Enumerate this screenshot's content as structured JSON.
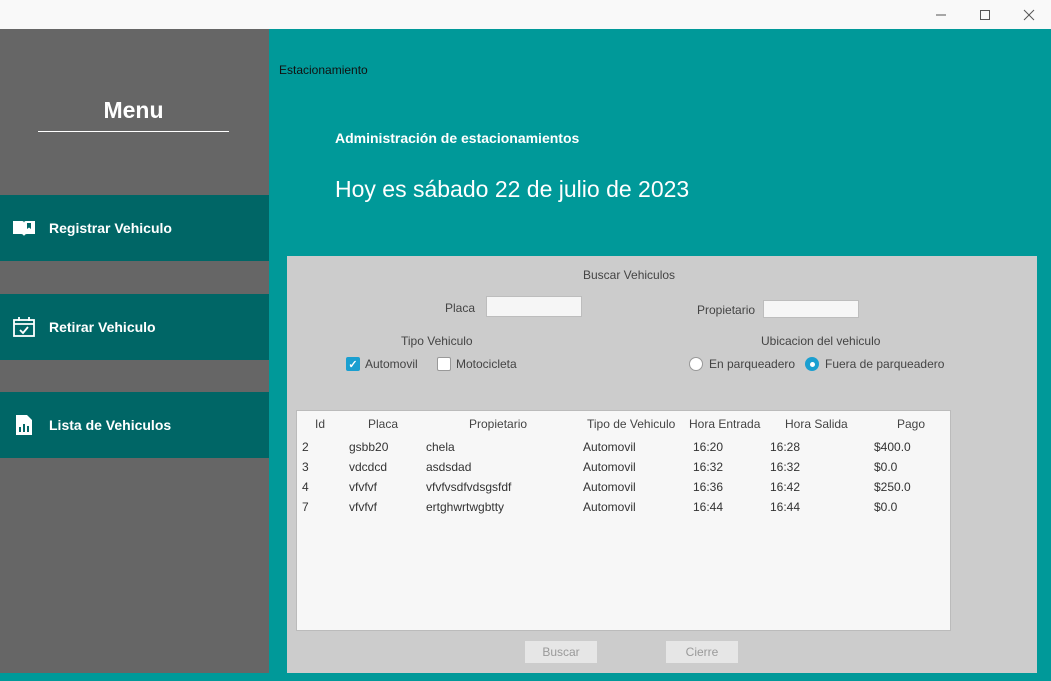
{
  "window": {
    "minimize": "—",
    "maximize": "☐",
    "close": "✕"
  },
  "sidebar": {
    "title": "Menu",
    "items": [
      {
        "label": "Registrar Vehiculo",
        "icon": "book-open-icon"
      },
      {
        "label": "Retirar Vehiculo",
        "icon": "calendar-check-icon"
      },
      {
        "label": "Lista de Vehiculos",
        "icon": "report-file-icon"
      }
    ]
  },
  "header": {
    "small_label": "Estacionamiento",
    "title": "Administración de estacionamientos",
    "date": "Hoy es sábado 22 de julio de 2023"
  },
  "search": {
    "title": "Buscar Vehiculos",
    "placa_label": "Placa",
    "placa_value": "",
    "propietario_label": "Propietario",
    "propietario_value": "",
    "tipo_label": "Tipo Vehiculo",
    "automovil_label": "Automovil",
    "automovil_checked": true,
    "motocicleta_label": "Motocicleta",
    "motocicleta_checked": false,
    "ubicacion_label": "Ubicacion del vehiculo",
    "en_parqueadero_label": "En parqueadero",
    "fuera_parqueadero_label": "Fuera de parqueadero",
    "selected_ubicacion": "Fuera de parqueadero"
  },
  "table": {
    "columns": [
      "Id",
      "Placa",
      "Propietario",
      "Tipo de Vehiculo",
      "Hora Entrada",
      "Hora Salida",
      "Pago"
    ],
    "rows": [
      [
        "2",
        "gsbb20",
        "chela",
        "Automovil",
        "16:20",
        "16:28",
        "$400.0"
      ],
      [
        "3",
        "vdcdcd",
        "asdsdad",
        "Automovil",
        "16:32",
        "16:32",
        "$0.0"
      ],
      [
        "4",
        "vfvfvf",
        "vfvfvsdfvdsgsfdf",
        "Automovil",
        "16:36",
        "16:42",
        "$250.0"
      ],
      [
        "7",
        "vfvfvf",
        "ertghwrtwgbtty",
        "Automovil",
        "16:44",
        "16:44",
        "$0.0"
      ]
    ]
  },
  "buttons": {
    "buscar": "Buscar",
    "cierre": "Cierre"
  },
  "colors": {
    "teal": "#009999",
    "dark_teal": "#006666",
    "sidebar_gray": "#666666",
    "panel_gray": "#cccccc",
    "accent_blue": "#1a9fd0"
  }
}
